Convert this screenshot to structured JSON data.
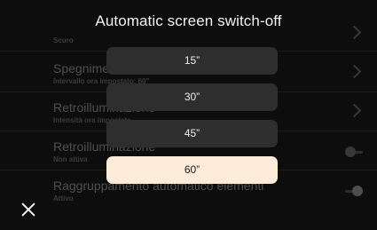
{
  "modal": {
    "title": "Automatic screen switch-off",
    "options": [
      {
        "label": "15”",
        "selected": false
      },
      {
        "label": "30”",
        "selected": false
      },
      {
        "label": "45”",
        "selected": false
      },
      {
        "label": "60”",
        "selected": true
      }
    ]
  },
  "background_list": {
    "items": [
      {
        "title": "",
        "subtitle": "Scuro",
        "control": "chevron"
      },
      {
        "title": "Spegnimento",
        "subtitle": "Intervallo ora impostato: 60”",
        "control": "chevron"
      },
      {
        "title": "Retroilluminazione",
        "subtitle": "Intensità ora impostata",
        "control": "chevron"
      },
      {
        "title": "Retroilluminazione",
        "subtitle": "Non attiva",
        "control": "toggle",
        "toggle_on": false
      },
      {
        "title": "Raggruppamento automatico elementi",
        "subtitle": "Attivo",
        "control": "toggle",
        "toggle_on": true
      }
    ]
  },
  "colors": {
    "selected_option_bg": "#fcebd9",
    "option_bg": "#2e2e2e",
    "screen_bg": "#141414"
  },
  "icons": {
    "close": "close-icon"
  }
}
